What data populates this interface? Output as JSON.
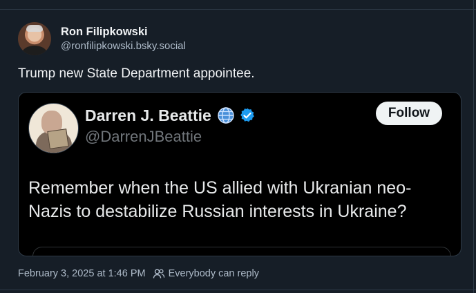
{
  "post": {
    "author": {
      "name": "Ron Filipkowski",
      "handle": "@ronfilipkowski.bsky.social"
    },
    "text": "Trump new State Department appointee.",
    "timestamp": "February 3, 2025 at 1:46 PM",
    "reply_setting": "Everybody can reply"
  },
  "embed": {
    "name": "Darren J. Beattie",
    "handle": "@DarrenJBeattie",
    "follow_label": "Follow",
    "text": "Remember when the US allied with Ukranian neo-Nazis to destabilize Russian interests in Ukraine?"
  },
  "colors": {
    "background": "#161e27",
    "embed_background": "#000000",
    "verified": "#1d9bf0"
  },
  "icons": {
    "globe": "globe-icon",
    "verified": "verified-badge-icon",
    "people": "people-icon"
  }
}
